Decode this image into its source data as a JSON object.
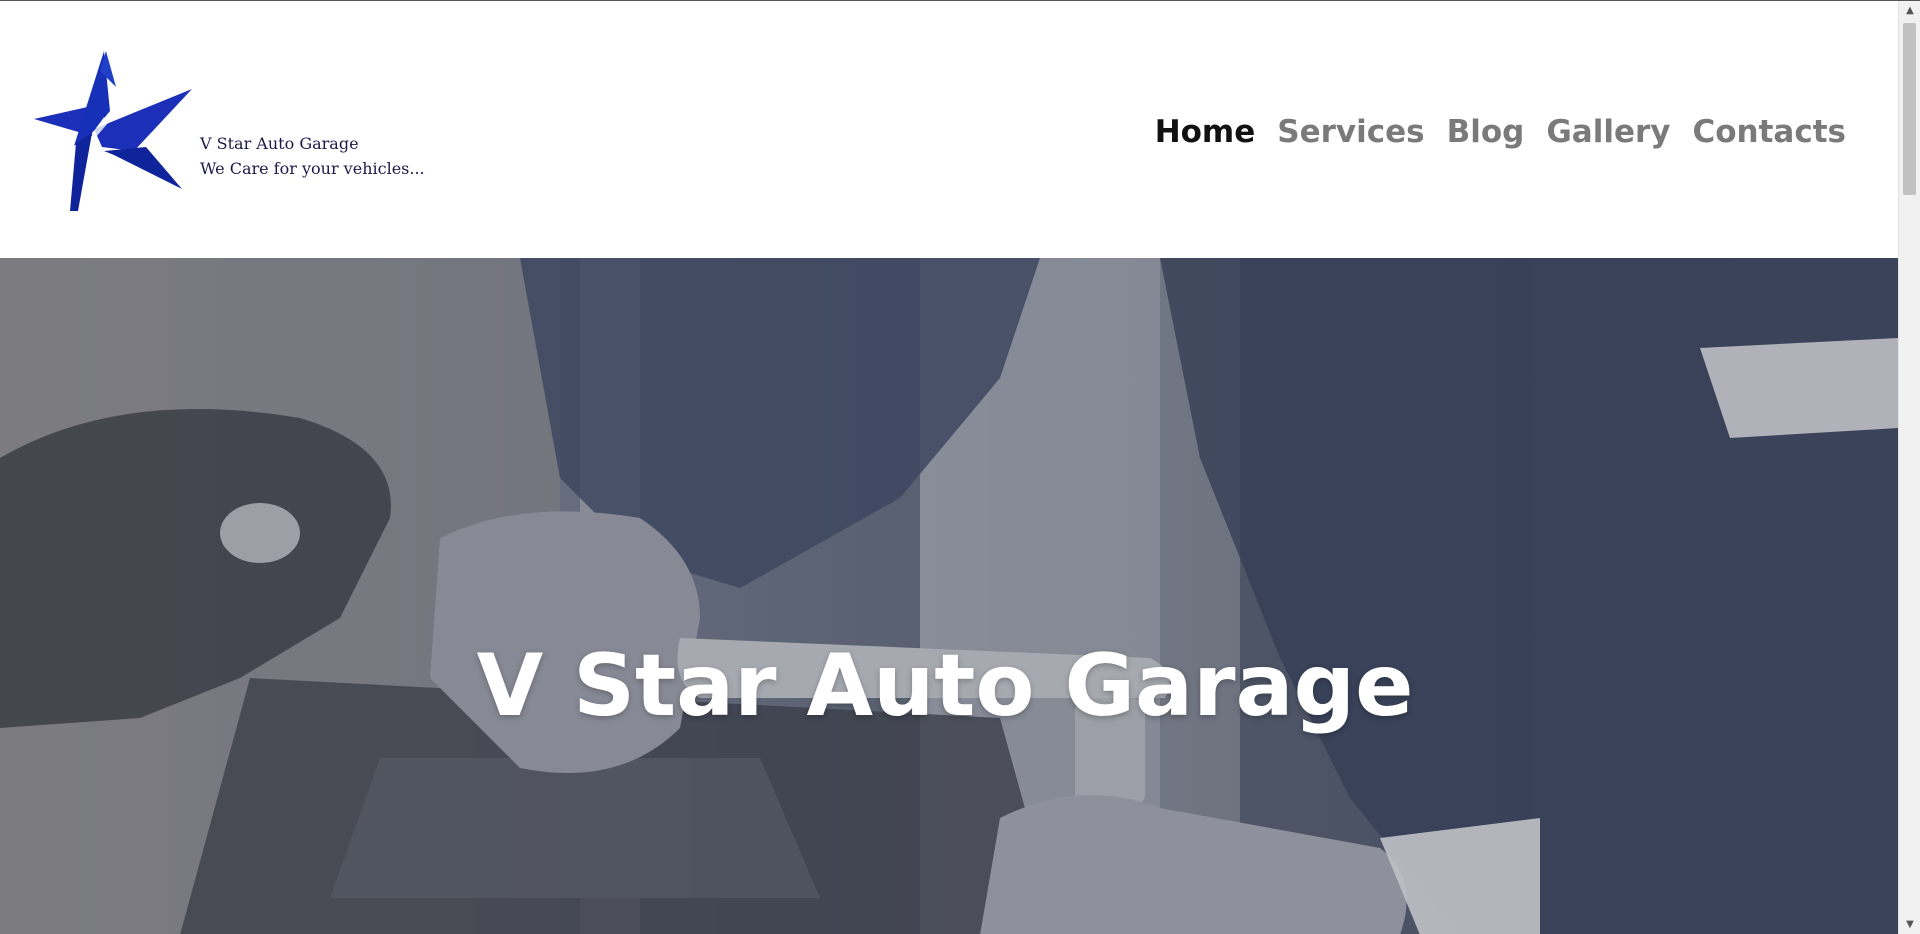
{
  "brand": {
    "name": "V Star Auto Garage",
    "tagline": "We Care for your vehicles...",
    "logo_color": "#1b2fb8"
  },
  "nav": {
    "items": [
      {
        "label": "Home",
        "active": true
      },
      {
        "label": "Services",
        "active": false
      },
      {
        "label": "Blog",
        "active": false
      },
      {
        "label": "Gallery",
        "active": false
      },
      {
        "label": "Contacts",
        "active": false
      }
    ]
  },
  "hero": {
    "title": "V Star Auto Garage",
    "image": "mechanic-with-ratchet-wrench"
  },
  "scrollbar": {
    "up_icon": "▲",
    "down_icon": "▼"
  }
}
